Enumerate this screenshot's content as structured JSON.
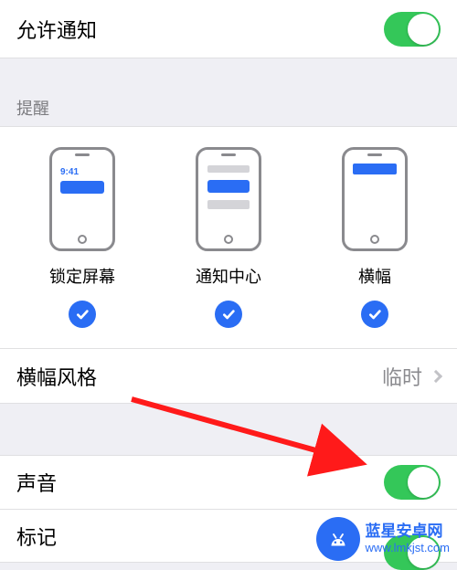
{
  "allow_notifications": {
    "label": "允许通知",
    "on": true
  },
  "alerts_section": {
    "title": "提醒"
  },
  "alert_options": {
    "lock_screen": {
      "label": "锁定屏幕",
      "time": "9:41",
      "checked": true
    },
    "notification_center": {
      "label": "通知中心",
      "checked": true
    },
    "banners": {
      "label": "横幅",
      "checked": true
    }
  },
  "banner_style": {
    "label": "横幅风格",
    "value": "临时"
  },
  "sounds": {
    "label": "声音",
    "on": true
  },
  "badges": {
    "label": "标记",
    "on": true
  },
  "watermark": {
    "title": "蓝星安卓网",
    "url": "www.lmkjst.com"
  },
  "colors": {
    "accent": "#34c759",
    "primary": "#2a6df4",
    "arrow": "#ff1a1a"
  }
}
